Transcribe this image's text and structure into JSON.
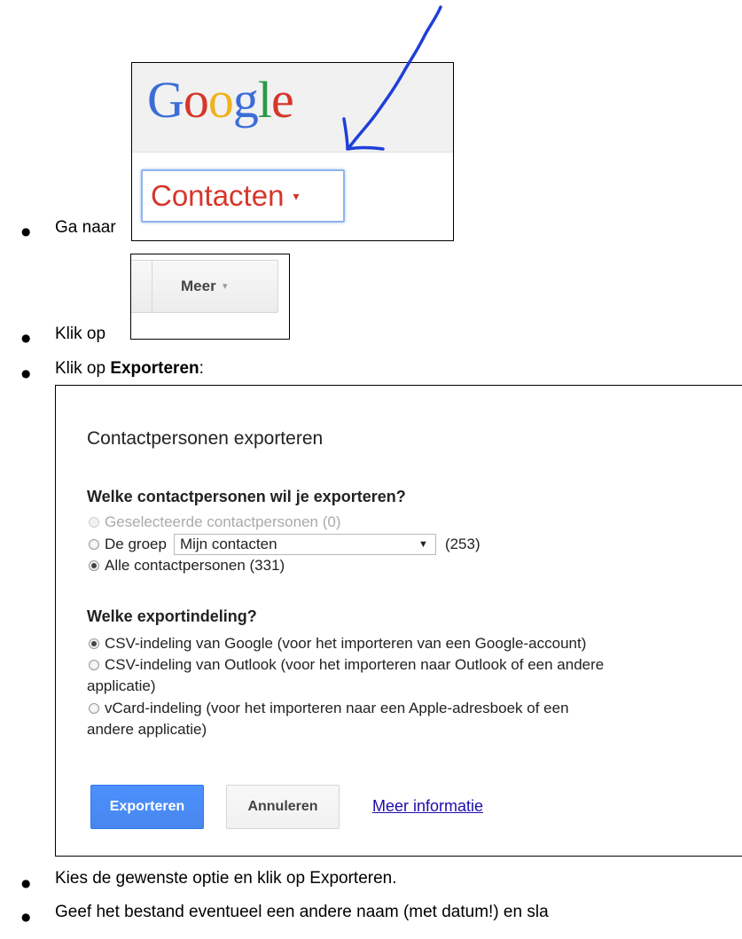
{
  "steps": [
    {
      "prefix": "Ga naar"
    },
    {
      "prefix": "Klik op"
    },
    {
      "prefix": "Klik op",
      "bold": "Exporteren",
      "suffix": ":"
    },
    {
      "text": "Kies de gewenste optie en klik op Exporteren."
    },
    {
      "text": "Geef het bestand eventueel een andere naam (met datum!) en sla"
    }
  ],
  "google_shot": {
    "logo_letters": [
      "G",
      "o",
      "o",
      "g",
      "l",
      "e"
    ],
    "contacten_label": "Contacten",
    "caret": "▾",
    "arrow_color": "#1e3fd8"
  },
  "meer_shot": {
    "label": "Meer",
    "caret": "▾"
  },
  "dialog": {
    "title": "Contactpersonen exporteren",
    "q1": "Welke contactpersonen wil je exporteren?",
    "opt_selected": "Geselecteerde contactpersonen (0)",
    "opt_group_prefix": "De groep",
    "group_select_value": "Mijn contacten",
    "group_select_caret": "▼",
    "group_count": "(253)",
    "opt_all": "Alle contactpersonen (331)",
    "q2": "Welke exportindeling?",
    "fmt_google": "CSV-indeling van Google (voor het importeren van een Google-account)",
    "fmt_outlook_line1": "CSV-indeling van Outlook (voor het importeren naar Outlook of een andere",
    "fmt_outlook_line2": "applicatie)",
    "fmt_vcard_line1": "vCard-indeling (voor het importeren naar een Apple-adresboek of een",
    "fmt_vcard_line2": "andere applicatie)",
    "btn_export": "Exporteren",
    "btn_cancel": "Annuleren",
    "link_info": "Meer informatie"
  },
  "colors": {
    "export_button": "#4d90fe",
    "contacten_red": "#d6362b",
    "link_blue": "#1a0dab"
  }
}
